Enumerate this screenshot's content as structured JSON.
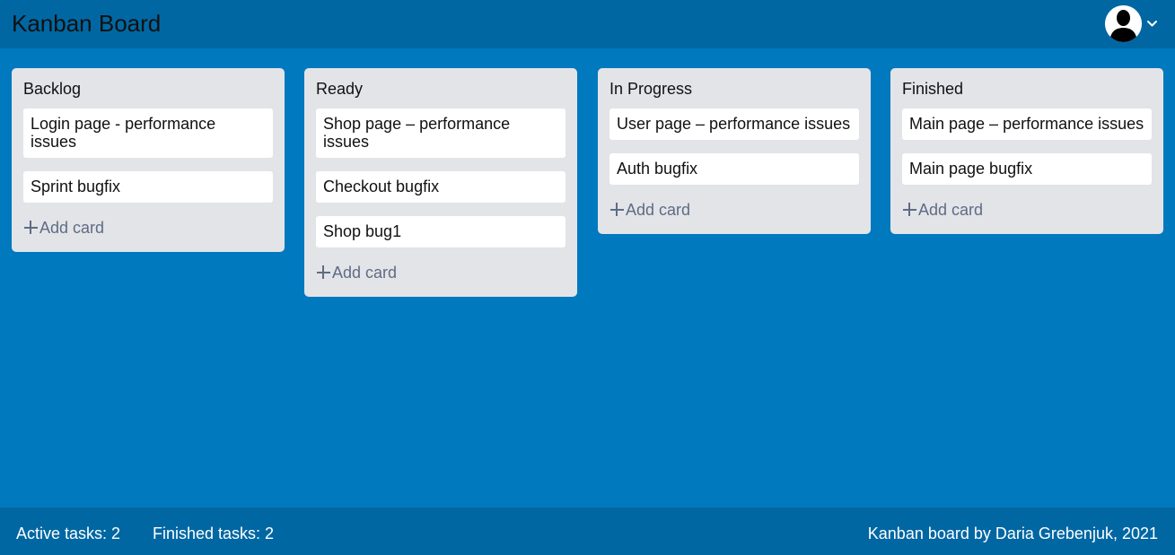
{
  "header": {
    "title": "Kanban Board",
    "avatar_icon": "user-silhouette-icon",
    "menu_icon": "chevron-down-icon"
  },
  "columns": [
    {
      "title": "Backlog",
      "cards": [
        "Login page - performance issues",
        "Sprint bugfix"
      ],
      "add_label": "Add card"
    },
    {
      "title": "Ready",
      "cards": [
        "Shop page – performance issues",
        "Checkout bugfix",
        "Shop bug1"
      ],
      "add_label": "Add card"
    },
    {
      "title": "In Progress",
      "cards": [
        "User page – performance issues",
        "Auth bugfix"
      ],
      "add_label": "Add card"
    },
    {
      "title": "Finished",
      "cards": [
        "Main page – performance issues",
        "Main page bugfix"
      ],
      "add_label": "Add card"
    }
  ],
  "footer": {
    "active_tasks": "Active tasks: 2",
    "finished_tasks": "Finished tasks: 2",
    "credit": "Kanban board by Daria Grebenjuk, 2021"
  },
  "colors": {
    "board_background": "#0079bf",
    "bar_background": "#0067a3",
    "column_background": "#e3e4e8",
    "card_background": "#ffffff"
  }
}
